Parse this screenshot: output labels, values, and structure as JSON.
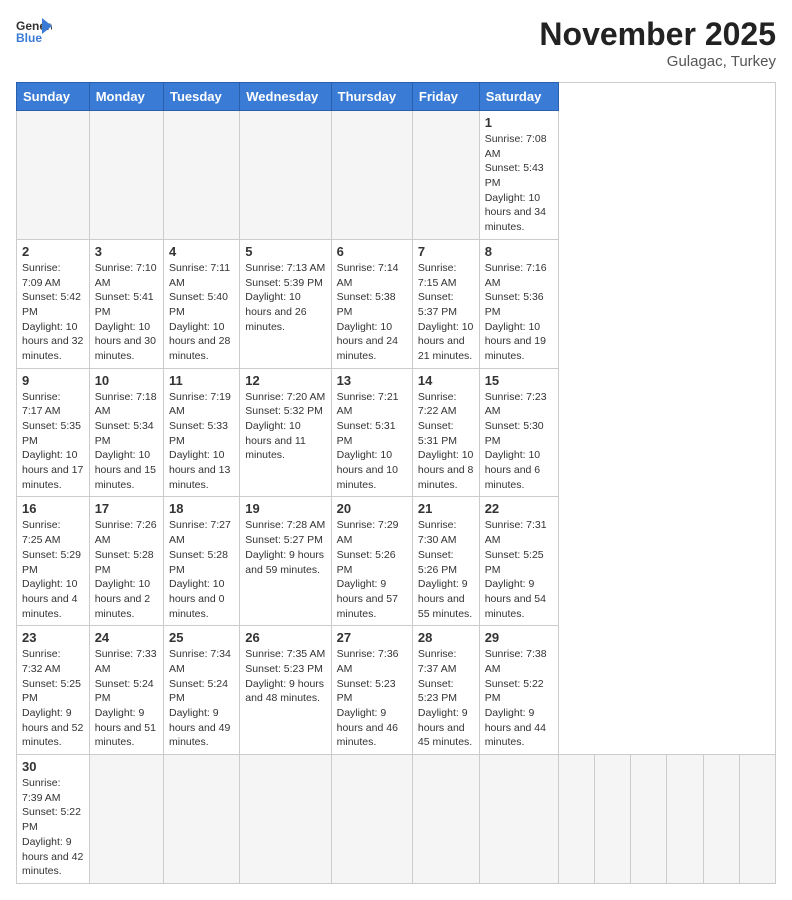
{
  "header": {
    "logo_general": "General",
    "logo_blue": "Blue",
    "month": "November 2025",
    "location": "Gulagac, Turkey"
  },
  "weekdays": [
    "Sunday",
    "Monday",
    "Tuesday",
    "Wednesday",
    "Thursday",
    "Friday",
    "Saturday"
  ],
  "days": [
    {
      "date": "",
      "sunrise": "",
      "sunset": "",
      "daylight": ""
    },
    {
      "date": "",
      "sunrise": "",
      "sunset": "",
      "daylight": ""
    },
    {
      "date": "",
      "sunrise": "",
      "sunset": "",
      "daylight": ""
    },
    {
      "date": "",
      "sunrise": "",
      "sunset": "",
      "daylight": ""
    },
    {
      "date": "",
      "sunrise": "",
      "sunset": "",
      "daylight": ""
    },
    {
      "date": "",
      "sunrise": "",
      "sunset": "",
      "daylight": ""
    },
    {
      "date": "1",
      "sunrise": "Sunrise: 7:08 AM",
      "sunset": "Sunset: 5:43 PM",
      "daylight": "Daylight: 10 hours and 34 minutes."
    },
    {
      "date": "2",
      "sunrise": "Sunrise: 7:09 AM",
      "sunset": "Sunset: 5:42 PM",
      "daylight": "Daylight: 10 hours and 32 minutes."
    },
    {
      "date": "3",
      "sunrise": "Sunrise: 7:10 AM",
      "sunset": "Sunset: 5:41 PM",
      "daylight": "Daylight: 10 hours and 30 minutes."
    },
    {
      "date": "4",
      "sunrise": "Sunrise: 7:11 AM",
      "sunset": "Sunset: 5:40 PM",
      "daylight": "Daylight: 10 hours and 28 minutes."
    },
    {
      "date": "5",
      "sunrise": "Sunrise: 7:13 AM",
      "sunset": "Sunset: 5:39 PM",
      "daylight": "Daylight: 10 hours and 26 minutes."
    },
    {
      "date": "6",
      "sunrise": "Sunrise: 7:14 AM",
      "sunset": "Sunset: 5:38 PM",
      "daylight": "Daylight: 10 hours and 24 minutes."
    },
    {
      "date": "7",
      "sunrise": "Sunrise: 7:15 AM",
      "sunset": "Sunset: 5:37 PM",
      "daylight": "Daylight: 10 hours and 21 minutes."
    },
    {
      "date": "8",
      "sunrise": "Sunrise: 7:16 AM",
      "sunset": "Sunset: 5:36 PM",
      "daylight": "Daylight: 10 hours and 19 minutes."
    },
    {
      "date": "9",
      "sunrise": "Sunrise: 7:17 AM",
      "sunset": "Sunset: 5:35 PM",
      "daylight": "Daylight: 10 hours and 17 minutes."
    },
    {
      "date": "10",
      "sunrise": "Sunrise: 7:18 AM",
      "sunset": "Sunset: 5:34 PM",
      "daylight": "Daylight: 10 hours and 15 minutes."
    },
    {
      "date": "11",
      "sunrise": "Sunrise: 7:19 AM",
      "sunset": "Sunset: 5:33 PM",
      "daylight": "Daylight: 10 hours and 13 minutes."
    },
    {
      "date": "12",
      "sunrise": "Sunrise: 7:20 AM",
      "sunset": "Sunset: 5:32 PM",
      "daylight": "Daylight: 10 hours and 11 minutes."
    },
    {
      "date": "13",
      "sunrise": "Sunrise: 7:21 AM",
      "sunset": "Sunset: 5:31 PM",
      "daylight": "Daylight: 10 hours and 10 minutes."
    },
    {
      "date": "14",
      "sunrise": "Sunrise: 7:22 AM",
      "sunset": "Sunset: 5:31 PM",
      "daylight": "Daylight: 10 hours and 8 minutes."
    },
    {
      "date": "15",
      "sunrise": "Sunrise: 7:23 AM",
      "sunset": "Sunset: 5:30 PM",
      "daylight": "Daylight: 10 hours and 6 minutes."
    },
    {
      "date": "16",
      "sunrise": "Sunrise: 7:25 AM",
      "sunset": "Sunset: 5:29 PM",
      "daylight": "Daylight: 10 hours and 4 minutes."
    },
    {
      "date": "17",
      "sunrise": "Sunrise: 7:26 AM",
      "sunset": "Sunset: 5:28 PM",
      "daylight": "Daylight: 10 hours and 2 minutes."
    },
    {
      "date": "18",
      "sunrise": "Sunrise: 7:27 AM",
      "sunset": "Sunset: 5:28 PM",
      "daylight": "Daylight: 10 hours and 0 minutes."
    },
    {
      "date": "19",
      "sunrise": "Sunrise: 7:28 AM",
      "sunset": "Sunset: 5:27 PM",
      "daylight": "Daylight: 9 hours and 59 minutes."
    },
    {
      "date": "20",
      "sunrise": "Sunrise: 7:29 AM",
      "sunset": "Sunset: 5:26 PM",
      "daylight": "Daylight: 9 hours and 57 minutes."
    },
    {
      "date": "21",
      "sunrise": "Sunrise: 7:30 AM",
      "sunset": "Sunset: 5:26 PM",
      "daylight": "Daylight: 9 hours and 55 minutes."
    },
    {
      "date": "22",
      "sunrise": "Sunrise: 7:31 AM",
      "sunset": "Sunset: 5:25 PM",
      "daylight": "Daylight: 9 hours and 54 minutes."
    },
    {
      "date": "23",
      "sunrise": "Sunrise: 7:32 AM",
      "sunset": "Sunset: 5:25 PM",
      "daylight": "Daylight: 9 hours and 52 minutes."
    },
    {
      "date": "24",
      "sunrise": "Sunrise: 7:33 AM",
      "sunset": "Sunset: 5:24 PM",
      "daylight": "Daylight: 9 hours and 51 minutes."
    },
    {
      "date": "25",
      "sunrise": "Sunrise: 7:34 AM",
      "sunset": "Sunset: 5:24 PM",
      "daylight": "Daylight: 9 hours and 49 minutes."
    },
    {
      "date": "26",
      "sunrise": "Sunrise: 7:35 AM",
      "sunset": "Sunset: 5:23 PM",
      "daylight": "Daylight: 9 hours and 48 minutes."
    },
    {
      "date": "27",
      "sunrise": "Sunrise: 7:36 AM",
      "sunset": "Sunset: 5:23 PM",
      "daylight": "Daylight: 9 hours and 46 minutes."
    },
    {
      "date": "28",
      "sunrise": "Sunrise: 7:37 AM",
      "sunset": "Sunset: 5:23 PM",
      "daylight": "Daylight: 9 hours and 45 minutes."
    },
    {
      "date": "29",
      "sunrise": "Sunrise: 7:38 AM",
      "sunset": "Sunset: 5:22 PM",
      "daylight": "Daylight: 9 hours and 44 minutes."
    },
    {
      "date": "30",
      "sunrise": "Sunrise: 7:39 AM",
      "sunset": "Sunset: 5:22 PM",
      "daylight": "Daylight: 9 hours and 42 minutes."
    }
  ]
}
